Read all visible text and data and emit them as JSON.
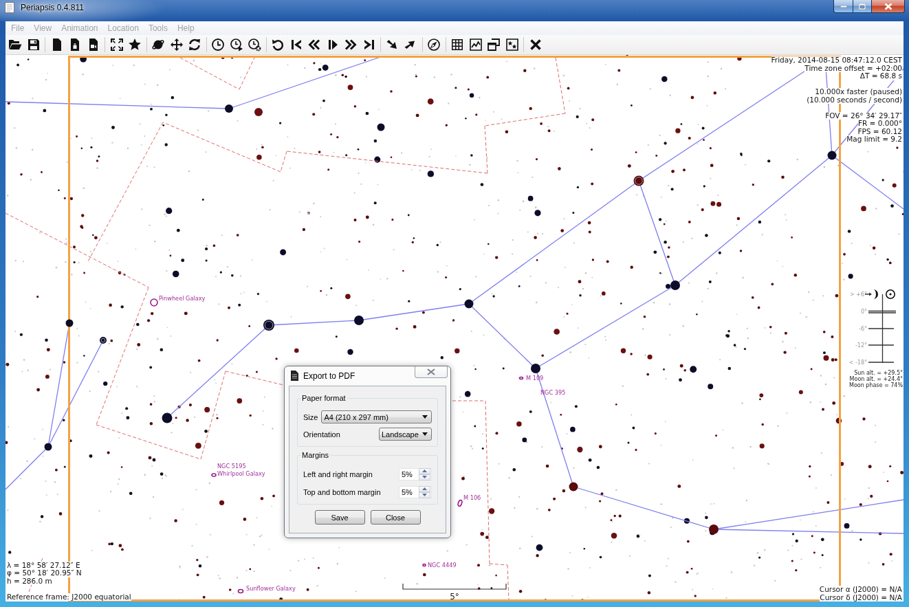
{
  "window": {
    "title": "Periapsis 0.4.811"
  },
  "menu": [
    {
      "label": "File",
      "disabled": true
    },
    {
      "label": "View",
      "disabled": true
    },
    {
      "label": "Animation",
      "disabled": true
    },
    {
      "label": "Location",
      "disabled": true
    },
    {
      "label": "Tools",
      "disabled": true
    },
    {
      "label": "Help",
      "disabled": true
    }
  ],
  "sky_map": {
    "time_info": [
      "Friday, 2014-08-15 08:47:12.0 CEST",
      "Time zone offset = +02:00",
      "ΔT = 68.8 s"
    ],
    "speed_info": [
      "10.000x faster (paused)",
      "(10.000 seconds / second)"
    ],
    "view_info": [
      "FOV = 26° 34′ 29.17″",
      "FR = 0.000°",
      "FPS = 60.12",
      "Mag limit = 9.2"
    ],
    "altitude_gauge": {
      "ticks": [
        "> +6°",
        "0°",
        "-6°",
        "-12°",
        "< -18°"
      ],
      "readings": [
        "Sun alt. = +29.5°",
        "Moon alt. = +24.4°",
        "Moon phase = 74%"
      ]
    },
    "object_labels": [
      "Pinwheel Galaxy",
      "M 109",
      "NGC 395",
      "NGC 5195",
      "Whirlpool Galaxy",
      "M 106",
      "NGC 4449",
      "Sunflower Galaxy"
    ],
    "scale_bar": {
      "label": "5°"
    },
    "location_info": [
      "λ = 18° 58′ 27.12″ E",
      "φ = 50° 18′ 20.95″ N",
      "h = 286.0 m"
    ],
    "reference_frame": "Reference frame: J2000 equatorial",
    "cursor_info": [
      "Cursor α (J2000) = N/A",
      "Cursor δ (J2000) = N/A"
    ]
  },
  "export_dialog": {
    "title": "Export to PDF",
    "groups": [
      {
        "title": "Paper format",
        "fields": [
          {
            "kind": "combo",
            "label": "Size",
            "value": "A4 (210 x 297 mm)"
          },
          {
            "kind": "combo",
            "label": "Orientation",
            "value": "Landscape"
          }
        ]
      },
      {
        "title": "Margins",
        "fields": [
          {
            "kind": "spin",
            "label": "Left and right margin",
            "value": "5%"
          },
          {
            "kind": "spin",
            "label": "Top and bottom margin",
            "value": "5%"
          }
        ]
      }
    ],
    "buttons": [
      "Save",
      "Close"
    ]
  }
}
